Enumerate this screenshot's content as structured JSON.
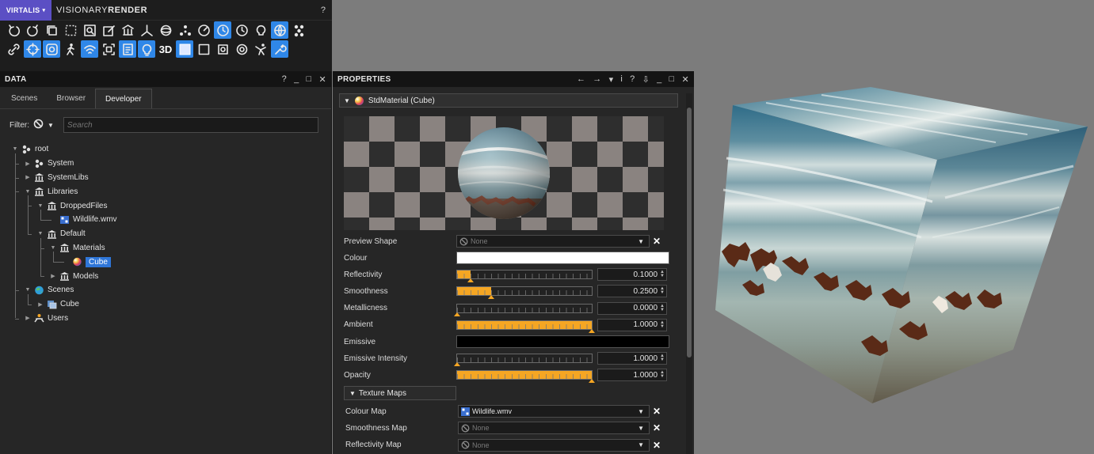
{
  "app": {
    "brand": "VIRTALIS",
    "title_light": "VISIONARY",
    "title_bold": "RENDER",
    "help": "?"
  },
  "toolbar": {
    "row1": [
      "undo-icon",
      "redo-icon",
      "copy-icon",
      "marquee-select-icon",
      "zoom-icon",
      "edit-icon",
      "bank-add-icon",
      "axes-icon",
      "sphere-icon",
      "nodes-icon",
      "gauge-icon",
      "clock-active-icon",
      "clock-icon",
      "bulb-cycle-icon",
      "network-active-icon",
      "molecule-icon"
    ],
    "row1_active": [
      11,
      14
    ],
    "row2": [
      "link-icon",
      "crosshair-active-icon",
      "scene-active-icon",
      "walk-icon",
      "wifi-active-icon",
      "frame-icon",
      "document-active-icon",
      "bulb-active-icon",
      "3d-label",
      "square-filled-icon",
      "square-outline-icon",
      "chip-icon",
      "settings-ring-icon",
      "figure-icon",
      "wrench-active-icon"
    ],
    "row2_active": [
      1,
      2,
      4,
      6,
      7,
      9,
      14
    ],
    "label_3d": "3D"
  },
  "data_panel": {
    "title": "DATA",
    "controls": [
      "?",
      "_",
      "□",
      "✕"
    ],
    "tabs": [
      {
        "label": "Scenes",
        "active": false
      },
      {
        "label": "Browser",
        "active": false
      },
      {
        "label": "Developer",
        "active": true
      }
    ],
    "filter_label": "Filter:",
    "search_placeholder": "Search",
    "tree": [
      {
        "label": "root",
        "depth": 0,
        "expanded": true,
        "icon": "nodes-icon"
      },
      {
        "label": "System",
        "depth": 1,
        "expanded": false,
        "icon": "nodes-icon"
      },
      {
        "label": "SystemLibs",
        "depth": 1,
        "expanded": false,
        "icon": "library-icon"
      },
      {
        "label": "Libraries",
        "depth": 1,
        "expanded": true,
        "icon": "library-icon"
      },
      {
        "label": "DroppedFiles",
        "depth": 2,
        "expanded": true,
        "icon": "library-icon"
      },
      {
        "label": "Wildlife.wmv",
        "depth": 3,
        "leaf": true,
        "icon": "video-icon"
      },
      {
        "label": "Default",
        "depth": 2,
        "expanded": true,
        "icon": "library-icon"
      },
      {
        "label": "Materials",
        "depth": 3,
        "expanded": true,
        "icon": "library-icon"
      },
      {
        "label": "Cube",
        "depth": 4,
        "leaf": true,
        "selected": true,
        "icon": "material-icon"
      },
      {
        "label": "Models",
        "depth": 3,
        "expanded": false,
        "icon": "library-icon"
      },
      {
        "label": "Scenes",
        "depth": 1,
        "expanded": true,
        "icon": "globe-icon"
      },
      {
        "label": "Cube",
        "depth": 2,
        "expanded": false,
        "icon": "scene-node-icon"
      },
      {
        "label": "Users",
        "depth": 1,
        "expanded": false,
        "icon": "users-icon"
      }
    ]
  },
  "props_panel": {
    "title": "PROPERTIES",
    "controls": [
      "←",
      "→",
      "▾",
      "i",
      "?",
      "⇩",
      "_",
      "□",
      "✕"
    ],
    "material_header": "StdMaterial (Cube)",
    "preview_shape": {
      "label": "Preview Shape",
      "value": "None"
    },
    "colour": {
      "label": "Colour",
      "color": "#ffffff"
    },
    "sliders": [
      {
        "label": "Reflectivity",
        "fraction": 0.1,
        "value": "0.1000"
      },
      {
        "label": "Smoothness",
        "fraction": 0.25,
        "value": "0.2500"
      },
      {
        "label": "Metallicness",
        "fraction": 0.0,
        "value": "0.0000"
      },
      {
        "label": "Ambient",
        "fraction": 1.0,
        "value": "1.0000"
      }
    ],
    "emissive": {
      "label": "Emissive",
      "color": "#000000"
    },
    "sliders2": [
      {
        "label": "Emissive Intensity",
        "fraction": 0.0,
        "value": "1.0000"
      },
      {
        "label": "Opacity",
        "fraction": 1.0,
        "value": "1.0000"
      }
    ],
    "texture_maps_label": "Texture Maps",
    "maps": [
      {
        "label": "Colour Map",
        "value": "Wildlife.wmv",
        "set": true
      },
      {
        "label": "Smoothness Map",
        "value": "None",
        "set": false
      },
      {
        "label": "Reflectivity Map",
        "value": "None",
        "set": false
      }
    ]
  },
  "colors": {
    "accent": "#2f87e8",
    "slider_fill": "#f5a623",
    "brand": "#5b4fc4"
  }
}
